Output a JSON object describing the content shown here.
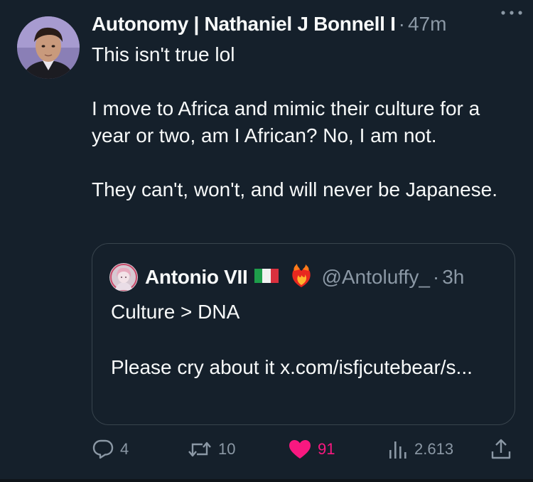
{
  "tweet": {
    "display_name": "Autonomy | Nathaniel J Bonnell I",
    "separator": "·",
    "time": "47m",
    "text": "This isn't true lol\n\nI move to Africa and mimic their culture for a year or two, am I African? No, I am not.\n\nThey can't, won't, and will never be Japanese."
  },
  "quote": {
    "display_name": "Antonio VII",
    "handle": "@Antoluffy_",
    "separator": "·",
    "time": "3h",
    "text": "Culture > DNA\n\nPlease cry about it x.com/isfjcutebear/s..."
  },
  "actions": {
    "replies": "4",
    "retweets": "10",
    "likes": "91",
    "views": "2.613"
  },
  "colors": {
    "background": "#15202b",
    "text": "#f7f9f9",
    "muted": "#8b98a5",
    "like": "#f91880",
    "border": "#38444d"
  },
  "icons": [
    "more-icon",
    "reply-icon",
    "retweet-icon",
    "heart-icon",
    "views-icon",
    "share-icon",
    "italy-flag-icon",
    "heart-on-fire-icon"
  ]
}
